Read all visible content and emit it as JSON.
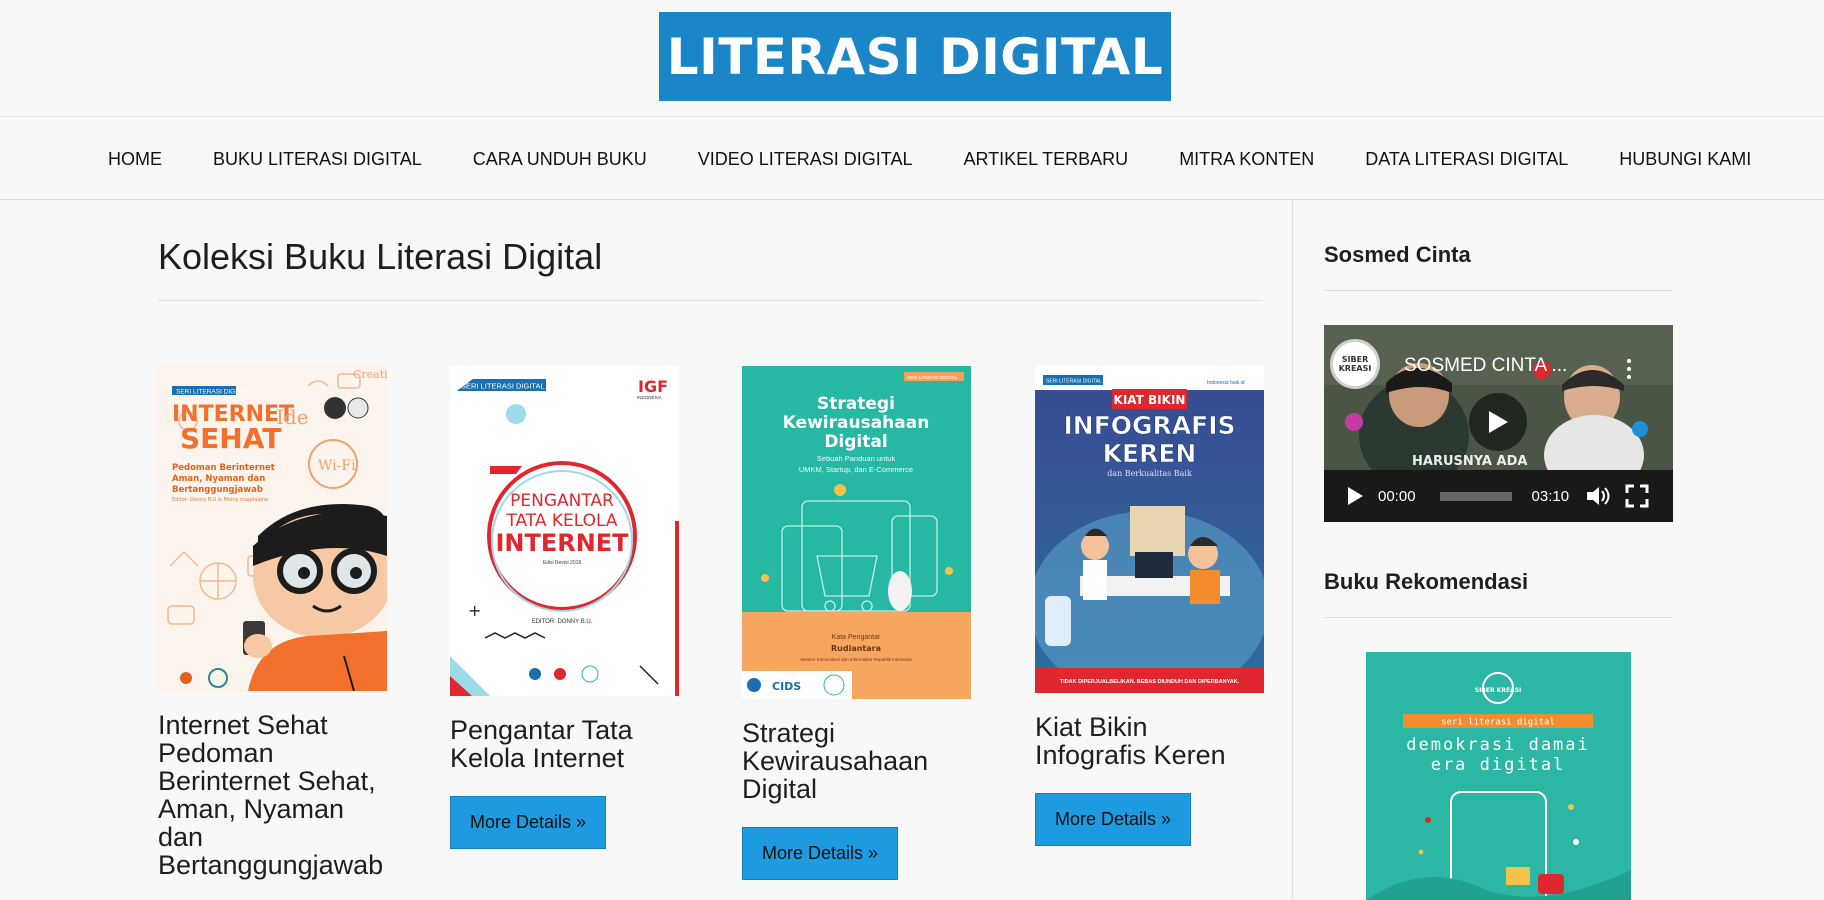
{
  "site": {
    "logo_text": "LITERASI DIGITAL"
  },
  "nav": {
    "items": [
      "HOME",
      "BUKU LITERASI DIGITAL",
      "CARA UNDUH BUKU",
      "VIDEO LITERASI DIGITAL",
      "ARTIKEL TERBARU",
      "MITRA KONTEN",
      "DATA LITERASI DIGITAL",
      "HUBUNGI KAMI"
    ]
  },
  "main": {
    "title": "Koleksi Buku Literasi Digital",
    "books": [
      {
        "title": "Internet Sehat Pedoman Berinternet Sehat, Aman, Nyaman dan Bertanggungjawab",
        "button": "More Details »",
        "cover": {
          "series": "SERI LITERASI DIGITAL",
          "headline1": "INTERNET",
          "headline2": "SEHAT",
          "sub": "Pedoman Berinternet Aman, Nyaman dan Bertanggungjawab",
          "editor": "Editor: Donny B.U & Meiny magdalena",
          "ide": "Ide",
          "wifi": "Wi-Fi",
          "creati": "Creati"
        }
      },
      {
        "title": "Pengantar Tata Kelola Internet",
        "button": "More Details »",
        "cover": {
          "series": "SERI LITERASI DIGITAL",
          "brand": "IGF",
          "brand_sub": "INDONESIA",
          "line1": "PENGANTAR",
          "line2": "TATA KELOLA",
          "line3": "INTERNET",
          "edition": "Edisi Revisi 2018",
          "editor": "EDITOR: DONNY B.U."
        }
      },
      {
        "title": "Strategi Kewirausahaan Digital",
        "button": "More Details »",
        "cover": {
          "series": "SERI LITERASI DIGITAL",
          "line1": "Strategi",
          "line2": "Kewirausahaan",
          "line3": "Digital",
          "sub1": "Sebuah Panduan untuk",
          "sub2": "UMKM, Startup, dan E-Commerce",
          "foreword": "Kata Pengantar",
          "author": "Rudiantara",
          "author_sub": "Menteri Komunikasi dan Informatika Republik Indonesia",
          "logo_a": "CIDS"
        }
      },
      {
        "title": "Kiat Bikin Infografis Keren",
        "button": "More Details »",
        "cover": {
          "series": "SERI LITERASI DIGITAL",
          "brand": "Indonesia baik.id",
          "tag": "KIAT BIKIN",
          "line1": "INFOGRAFIS",
          "line2": "KEREN",
          "sub": "dan Berkualitas Baik",
          "footer": "TIDAK DIPERJUALBELIKAN. BEBAS DIUNDUH DAN DIPERBANYAK."
        }
      }
    ]
  },
  "sidebar": {
    "widget1_title": "Sosmed Cinta",
    "video": {
      "title": "SOSMED CINTA ...",
      "channel_logo": "SIBER KREASI",
      "current_time": "00:00",
      "duration": "03:10",
      "overlay_caption": "HARUSNYA ADA"
    },
    "widget2_title": "Buku Rekomendasi",
    "rec_book": {
      "brand": "SIBER KREASI",
      "tag": "seri literasi digital",
      "line1": "demokrasi damai",
      "line2": "era digital"
    }
  },
  "colors": {
    "brand_blue": "#1a86c8",
    "button_blue": "#1e9ae0",
    "teal": "#2bb7a4"
  }
}
